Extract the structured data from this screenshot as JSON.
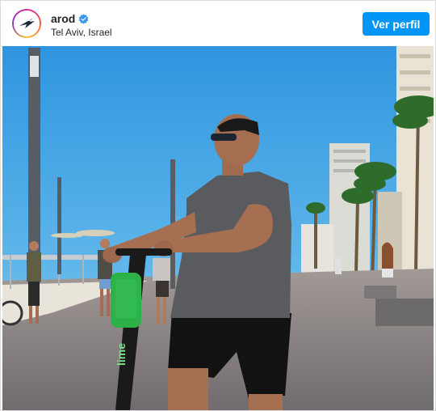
{
  "post": {
    "username": "arod",
    "location": "Tel Aviv, Israel",
    "profile_button_label": "Ver perfil",
    "verified": true,
    "photo_scene": {
      "scooter_brand_text": "lime"
    }
  },
  "colors": {
    "accent": "#0095f6",
    "sky": "#3ca3e3",
    "scooter_green": "#2db24a"
  },
  "icons": [
    "avatar-logo-icon",
    "verified-badge-icon"
  ]
}
